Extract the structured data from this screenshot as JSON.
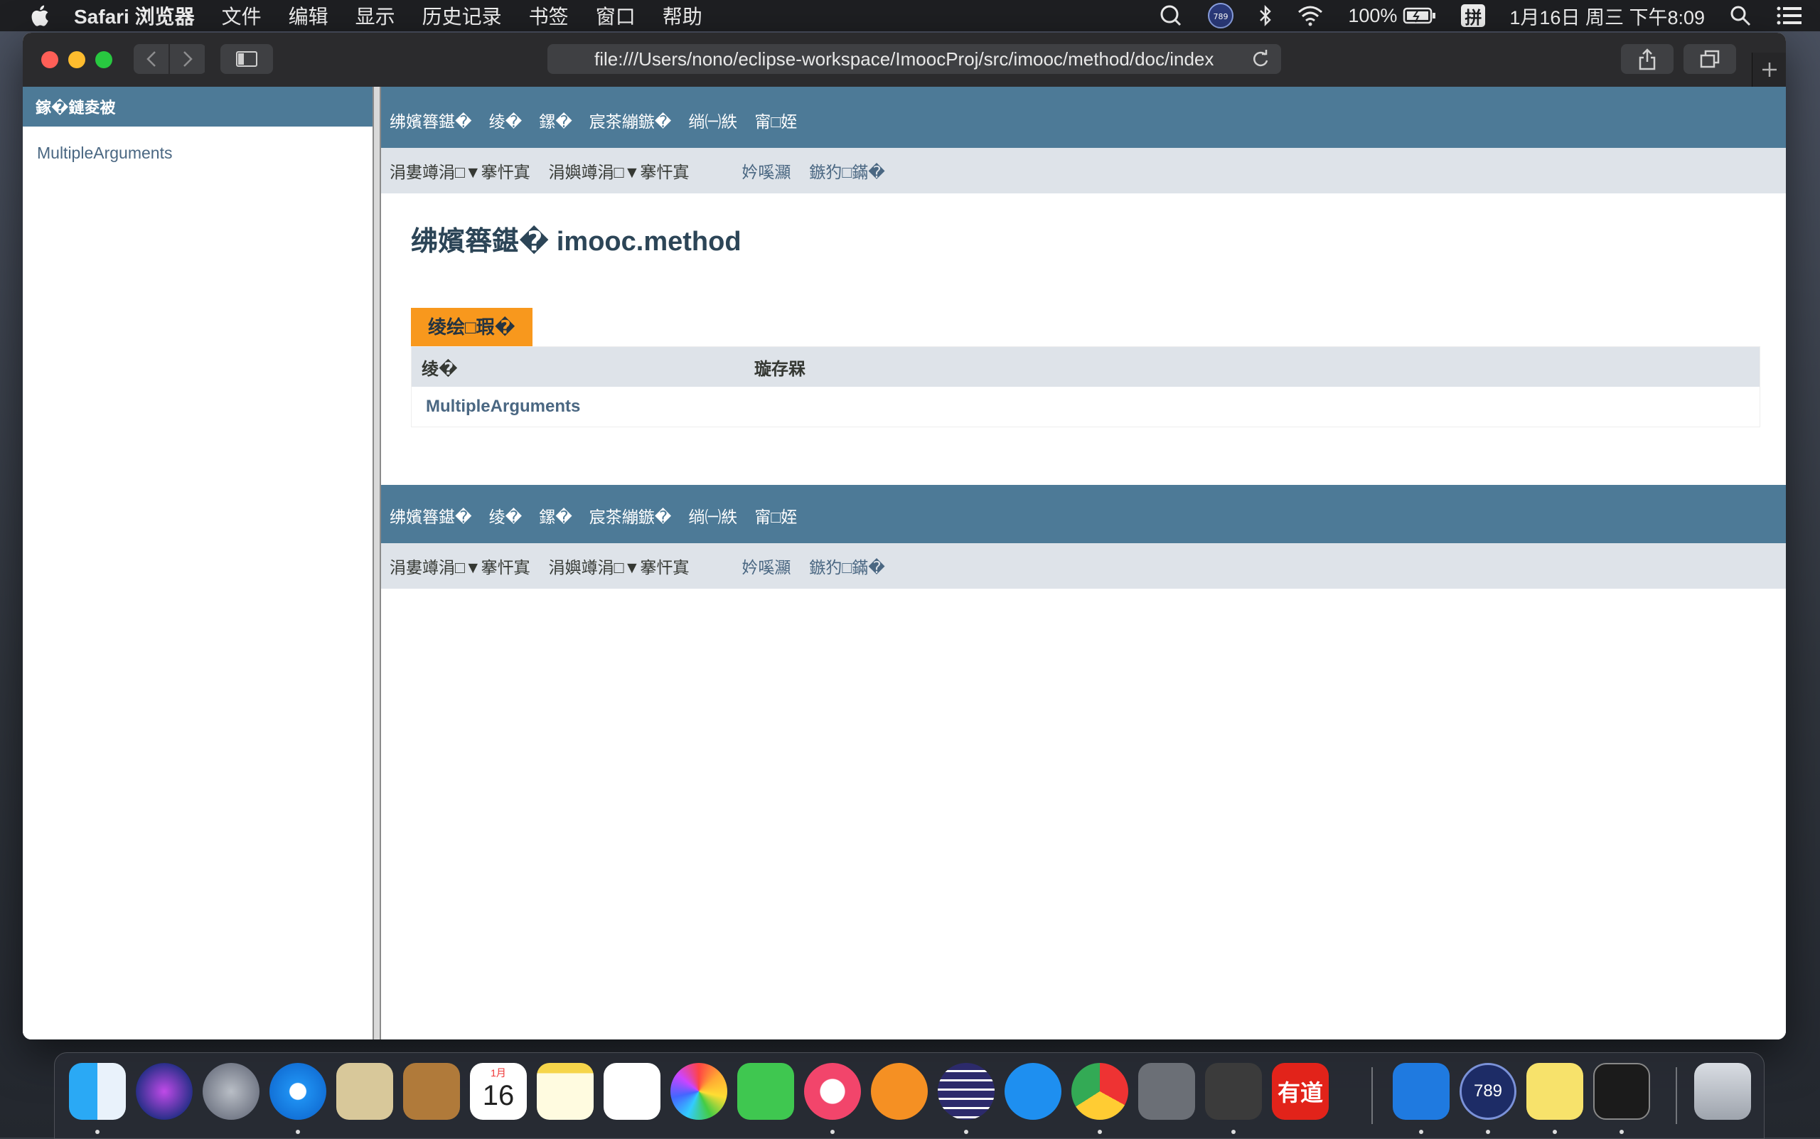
{
  "menubar": {
    "items": [
      "Safari 浏览器",
      "文件",
      "编辑",
      "显示",
      "历史记录",
      "书签",
      "窗口",
      "帮助"
    ],
    "battery": "100%",
    "input_method": "拼",
    "datetime": "1月16日 周三 下午8:09"
  },
  "browser": {
    "url": "file:///Users/nono/eclipse-workspace/ImoocProj/src/imooc/method/doc/index"
  },
  "left_frame": {
    "header": "鎵�鏈夌被",
    "class_link": "MultipleArguments"
  },
  "nav": {
    "top": [
      "绋嬪簭鍖�",
      "绫�",
      "鏍�",
      "宸茶繃鏃�",
      "绱㈠紩",
      "甯□姪"
    ],
    "sub_left": [
      "涓婁竴涓□▼搴忓寘",
      "涓嬩竴涓□▼搴忓寘"
    ],
    "sub_right": [
      "妗嗘灦",
      "鏃犳□鏋�"
    ]
  },
  "main": {
    "title": "绋嬪簭鍖� imooc.method",
    "summary_caption": "绫绘□瑕�",
    "table_headers": [
      "绫�",
      "璇存槑"
    ],
    "rows": [
      {
        "class": "MultipleArguments",
        "description": ""
      }
    ]
  },
  "dock": {
    "apps": [
      "finder-icon",
      "siri-icon",
      "launchpad-icon",
      "safari-icon",
      "mail-icon",
      "contacts-icon",
      "calendar-icon",
      "notes-icon",
      "reminders-icon",
      "photos-icon",
      "facetime-icon",
      "itunes-icon",
      "books-icon",
      "eclipse-icon",
      "app-store-icon",
      "chrome-icon",
      "system-preferences-icon",
      "sublime-text-icon",
      "youdao-icon",
      "xcode-icon",
      "789-icon",
      "stickies-icon",
      "terminal-icon",
      "trash-icon"
    ],
    "calendar_month": "1月",
    "calendar_day": "16",
    "youdao_label": "有道",
    "badge_789": "789"
  },
  "colors": {
    "nav_blue": "#4d7a97",
    "subnav_gray": "#dee3e9",
    "caption_orange": "#f8981d",
    "link": "#4a6782"
  }
}
